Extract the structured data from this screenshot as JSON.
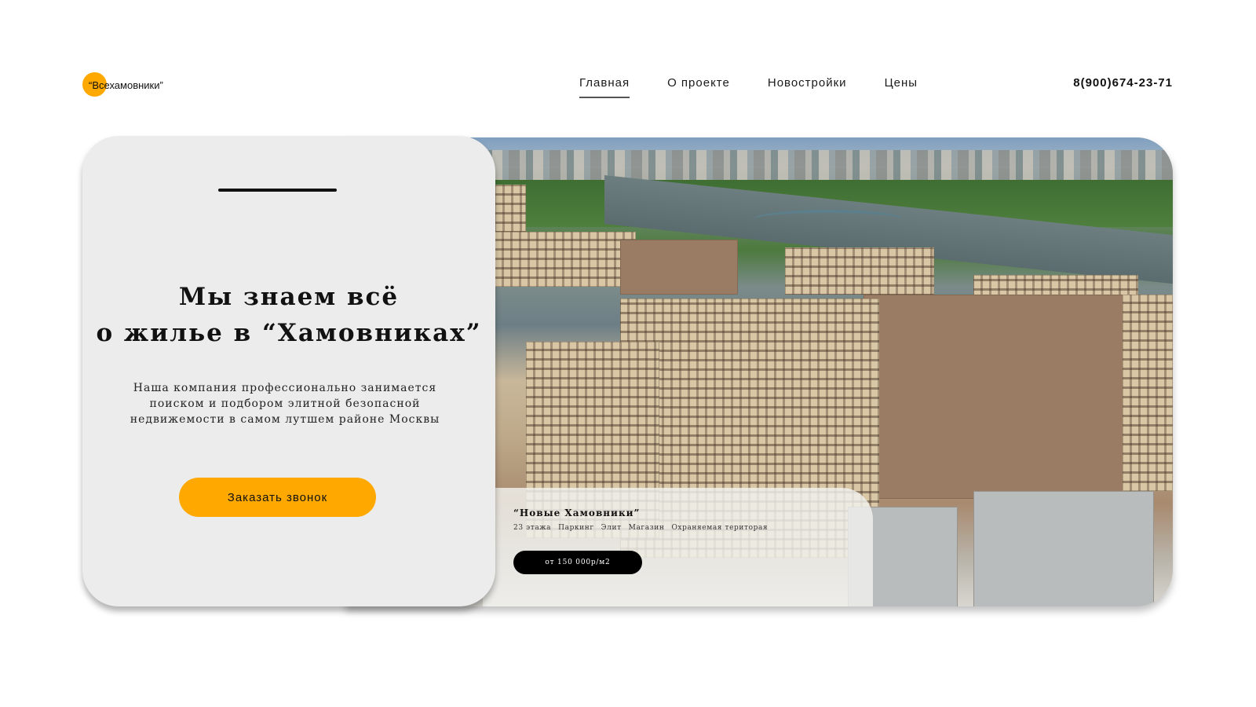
{
  "header": {
    "logo_text": "“Всехамовники”",
    "nav": [
      {
        "label": "Главная",
        "active": true
      },
      {
        "label": "О проекте",
        "active": false
      },
      {
        "label": "Новостройки",
        "active": false
      },
      {
        "label": "Цены",
        "active": false
      }
    ],
    "phone": "8(900)674-23-71"
  },
  "hero": {
    "title_line1": "Мы знаем всё",
    "title_line2": "о жилье в “Хамовниках”",
    "description_lines": [
      "Наша компания профессионально занимается",
      "поиском и подбором элитной безопасной",
      "недвижемости в самом лутшем районе Москвы"
    ],
    "cta_label": "Заказать звонок"
  },
  "property": {
    "title": "“Новые Хамовники”",
    "tags": [
      "23 этажа",
      "Паркинг",
      "Элит",
      "Магазин",
      "Охраняемая територая"
    ],
    "price": "от 150 000р/м2"
  },
  "colors": {
    "accent": "#ffa800",
    "card_bg": "#ececec",
    "price_badge_bg": "#000000"
  }
}
